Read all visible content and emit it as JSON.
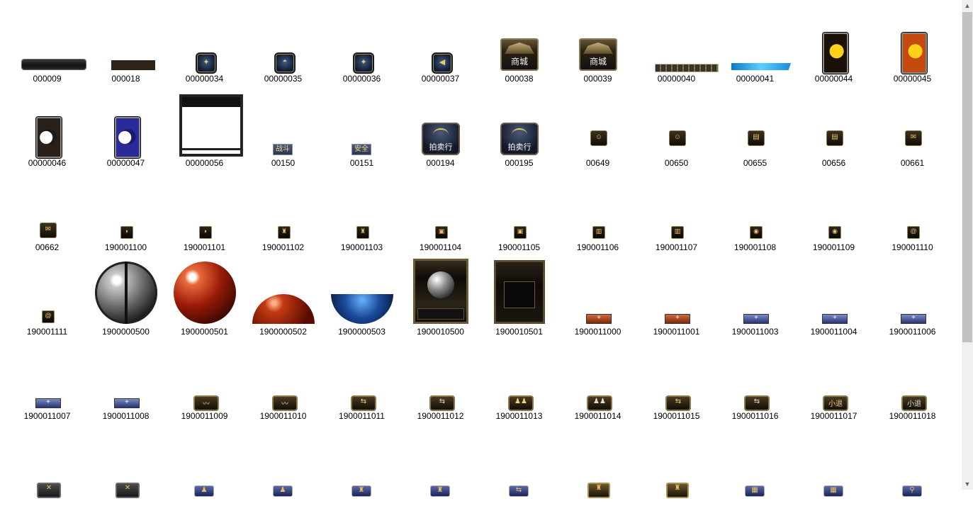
{
  "files": [
    {
      "name": "000009",
      "art": "bar-dark"
    },
    {
      "name": "000018",
      "art": "bar-strip"
    },
    {
      "name": "00000034",
      "art": "icon-round",
      "glyph": "✦"
    },
    {
      "name": "00000035",
      "art": "icon-round",
      "glyph": "◓"
    },
    {
      "name": "00000036",
      "art": "icon-round",
      "glyph": "✦"
    },
    {
      "name": "00000037",
      "art": "icon-round",
      "glyph": "◀"
    },
    {
      "name": "000038",
      "art": "palace",
      "glyph": "商城"
    },
    {
      "name": "000039",
      "art": "palace",
      "glyph": "商城"
    },
    {
      "name": "00000040",
      "art": "ribbon"
    },
    {
      "name": "00000041",
      "art": "glow-bar"
    },
    {
      "name": "00000044",
      "art": "sun"
    },
    {
      "name": "00000045",
      "art": "sun2"
    },
    {
      "name": "00000046",
      "art": "moon"
    },
    {
      "name": "00000047",
      "art": "moon2"
    },
    {
      "name": "00000056",
      "art": "frame"
    },
    {
      "name": "00150",
      "art": "mini-tag",
      "glyph": "战斗"
    },
    {
      "name": "00151",
      "art": "mini-tag",
      "glyph": "安全"
    },
    {
      "name": "000194",
      "art": "scales",
      "glyph": "拍卖行"
    },
    {
      "name": "000195",
      "art": "scales",
      "glyph": "拍卖行"
    },
    {
      "name": "00649",
      "art": "sq",
      "glyph": "☺"
    },
    {
      "name": "00650",
      "art": "sq",
      "glyph": "☺"
    },
    {
      "name": "00655",
      "art": "sq",
      "glyph": "▤"
    },
    {
      "name": "00656",
      "art": "sq",
      "glyph": "▤"
    },
    {
      "name": "00661",
      "art": "sq",
      "glyph": "✉"
    },
    {
      "name": "00662",
      "art": "sq",
      "glyph": "✉"
    },
    {
      "name": "190001100",
      "art": "small",
      "glyph": "◗"
    },
    {
      "name": "190001101",
      "art": "small",
      "glyph": "◗"
    },
    {
      "name": "190001102",
      "art": "small",
      "glyph": "♜"
    },
    {
      "name": "190001103",
      "art": "small",
      "glyph": "♜"
    },
    {
      "name": "190001104",
      "art": "small",
      "glyph": "▣"
    },
    {
      "name": "190001105",
      "art": "small",
      "glyph": "▣"
    },
    {
      "name": "190001106",
      "art": "small",
      "glyph": "▥"
    },
    {
      "name": "190001107",
      "art": "small",
      "glyph": "▥"
    },
    {
      "name": "190001108",
      "art": "small",
      "glyph": "◉"
    },
    {
      "name": "190001109",
      "art": "small",
      "glyph": "◉"
    },
    {
      "name": "190001110",
      "art": "small",
      "glyph": "@"
    },
    {
      "name": "190001111",
      "art": "small",
      "glyph": "@"
    },
    {
      "name": "1900000500",
      "art": "orb-gray"
    },
    {
      "name": "1900000501",
      "art": "orb-red"
    },
    {
      "name": "1900000502",
      "art": "half-red"
    },
    {
      "name": "1900000503",
      "art": "half-blue"
    },
    {
      "name": "1900010500",
      "art": "ornate"
    },
    {
      "name": "1900010501",
      "art": "ornate2"
    },
    {
      "name": "1900011000",
      "art": "pt-red",
      "glyph": "+"
    },
    {
      "name": "1900011001",
      "art": "pt-red",
      "glyph": "+"
    },
    {
      "name": "1900011003",
      "art": "pt-blue",
      "glyph": "+"
    },
    {
      "name": "1900011004",
      "art": "pt-blue",
      "glyph": "+"
    },
    {
      "name": "1900011006",
      "art": "pt-blue",
      "glyph": "+"
    },
    {
      "name": "1900011007",
      "art": "pt-blue",
      "glyph": "+"
    },
    {
      "name": "1900011008",
      "art": "pt-blue",
      "glyph": "+"
    },
    {
      "name": "1900011009",
      "art": "btn",
      "glyph": "〰"
    },
    {
      "name": "1900011010",
      "art": "btn-plain",
      "glyph": "〰"
    },
    {
      "name": "1900011011",
      "art": "btn",
      "glyph": "⇆"
    },
    {
      "name": "1900011012",
      "art": "btn-plain",
      "glyph": "⇆"
    },
    {
      "name": "1900011013",
      "art": "btn",
      "glyph": "♟♟"
    },
    {
      "name": "1900011014",
      "art": "btn-plain",
      "glyph": "♟♟"
    },
    {
      "name": "1900011015",
      "art": "btn",
      "glyph": "⇆"
    },
    {
      "name": "1900011016",
      "art": "btn-plain",
      "glyph": "⇆"
    },
    {
      "name": "1900011017",
      "art": "btn",
      "glyph": "小退"
    },
    {
      "name": "1900011018",
      "art": "btn-plain",
      "glyph": "小退"
    },
    {
      "name": "",
      "art": "peek",
      "glyph": "✕"
    },
    {
      "name": "",
      "art": "peek",
      "glyph": "✕"
    },
    {
      "name": "",
      "art": "peek-blue",
      "glyph": "♟"
    },
    {
      "name": "",
      "art": "peek-blue",
      "glyph": "♟"
    },
    {
      "name": "",
      "art": "peek-blue",
      "glyph": "♜"
    },
    {
      "name": "",
      "art": "peek-blue",
      "glyph": "♜"
    },
    {
      "name": "",
      "art": "peek-blue",
      "glyph": "⇆"
    },
    {
      "name": "",
      "art": "peek-gold",
      "glyph": "♜"
    },
    {
      "name": "",
      "art": "peek-gold",
      "glyph": "♜"
    },
    {
      "name": "",
      "art": "peek-blue",
      "glyph": "▦"
    },
    {
      "name": "",
      "art": "peek-blue",
      "glyph": "▦"
    },
    {
      "name": "",
      "art": "peek-blue",
      "glyph": "⚲"
    }
  ],
  "scrollbar": {
    "up_icon": "▲",
    "down_icon": "▼",
    "thumb_fraction": 0.69
  }
}
